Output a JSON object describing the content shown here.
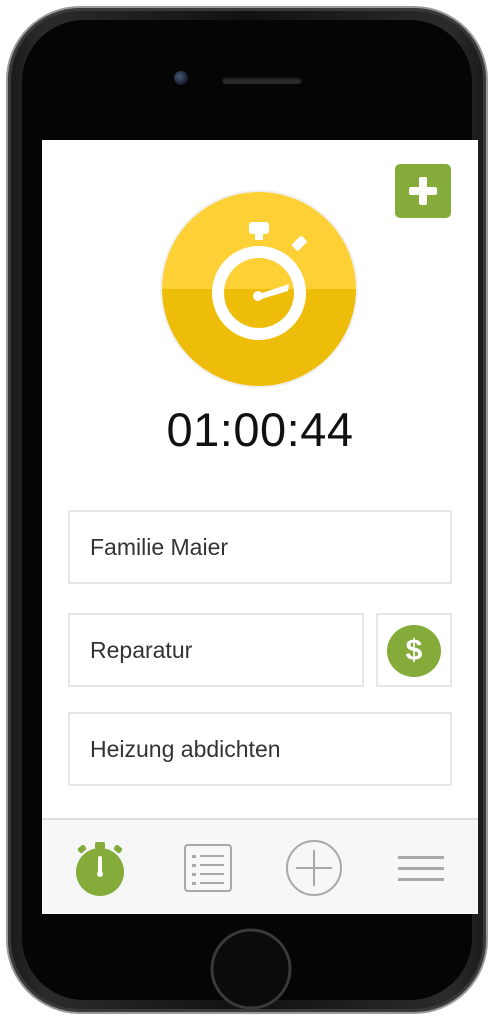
{
  "colors": {
    "accent_green": "#85ab3b",
    "timer_yellow_light": "#fdd036",
    "timer_yellow_dark": "#eebd0a",
    "icon_gray": "#a8a8a8"
  },
  "header": {
    "add_icon": "plus-icon"
  },
  "timer": {
    "icon": "stopwatch-icon",
    "elapsed": "01:00:44"
  },
  "form": {
    "customer": "Familie Maier",
    "activity": "Reparatur",
    "billing_icon": "dollar-icon",
    "billing_symbol": "$",
    "note": "Heizung abdichten"
  },
  "tabbar": {
    "items": [
      {
        "icon": "stopwatch-icon",
        "active": true
      },
      {
        "icon": "list-icon",
        "active": false
      },
      {
        "icon": "plus-circle-icon",
        "active": false
      },
      {
        "icon": "hamburger-menu-icon",
        "active": false
      }
    ]
  }
}
